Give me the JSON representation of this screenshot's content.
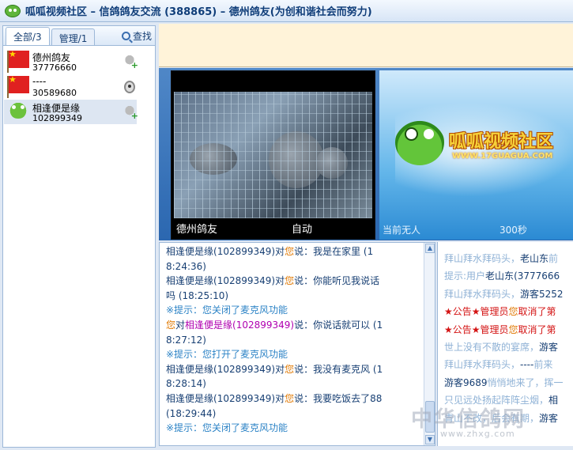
{
  "window": {
    "title": "呱呱视频社区 – 信鸽鸽友交流 (388865) – 德州鸽友(为创和谐社会而努力)"
  },
  "sidebar": {
    "tabs": [
      {
        "label": "全部/3",
        "active": true
      },
      {
        "label": "管理/1",
        "active": false
      }
    ],
    "find_label": "查找",
    "users": [
      {
        "name": "德州鸽友",
        "id": "37776660",
        "avatar": "china-flag-icon",
        "device": "microphone-icon"
      },
      {
        "name": "----",
        "id": "30589680",
        "avatar": "china-flag-icon",
        "device": "webcam-icon"
      },
      {
        "name": "相逢便是缘",
        "id": "102899349",
        "avatar": "frog-icon",
        "device": "microphone-icon"
      }
    ]
  },
  "video": {
    "left": {
      "owner": "德州鸽友",
      "mode": "自动"
    },
    "right": {
      "status": "当前无人",
      "timer": "300秒",
      "brand": "呱呱视频社区",
      "brand_url": "WWW.17GUAGUA.COM"
    }
  },
  "chat": {
    "lines": [
      [
        {
          "t": "相逢便是缘",
          "c": "n1"
        },
        {
          "t": "(102899349)对",
          "c": "n1"
        },
        {
          "t": "您",
          "c": "you"
        },
        {
          "t": "说：我是在家里 (1",
          "c": "n1"
        }
      ],
      [
        {
          "t": "8:24:36)",
          "c": "n1"
        }
      ],
      [
        {
          "t": "相逢便是缘",
          "c": "n1"
        },
        {
          "t": "(102899349)对",
          "c": "n1"
        },
        {
          "t": "您",
          "c": "you"
        },
        {
          "t": "说：你能听见我说话",
          "c": "n1"
        }
      ],
      [
        {
          "t": "吗 (18:25:10)",
          "c": "n1"
        }
      ],
      [
        {
          "t": "※提示：您关闭了麦克风功能",
          "c": "tip"
        }
      ],
      [
        {
          "t": "您",
          "c": "you"
        },
        {
          "t": "对",
          "c": "n1"
        },
        {
          "t": "相逢便是缘(102899349)",
          "c": "n2"
        },
        {
          "t": "说：你说话就可以 (1",
          "c": "n1"
        }
      ],
      [
        {
          "t": "8:27:12)",
          "c": "n1"
        }
      ],
      [
        {
          "t": "※提示：您打开了麦克风功能",
          "c": "tip"
        }
      ],
      [
        {
          "t": "相逢便是缘",
          "c": "n1"
        },
        {
          "t": "(102899349)对",
          "c": "n1"
        },
        {
          "t": "您",
          "c": "you"
        },
        {
          "t": "说：我没有麦克风 (1",
          "c": "n1"
        }
      ],
      [
        {
          "t": "8:28:14)",
          "c": "n1"
        }
      ],
      [
        {
          "t": "相逢便是缘",
          "c": "n1"
        },
        {
          "t": "(102899349)对",
          "c": "n1"
        },
        {
          "t": "您",
          "c": "you"
        },
        {
          "t": "说：我要吃饭去了88",
          "c": "n1"
        }
      ],
      [
        {
          "t": "(18:29:44)",
          "c": "n1"
        }
      ],
      [
        {
          "t": "※提示：您关闭了麦克风功能",
          "c": "tip"
        }
      ]
    ]
  },
  "public_chat": {
    "lines": [
      [
        {
          "t": "拜山拜水拜码头，",
          "c": "faint"
        },
        {
          "t": "老山东",
          "c": "dark"
        },
        {
          "t": "前",
          "c": "faint"
        }
      ],
      [
        {
          "t": "提示:用户",
          "c": "faint"
        },
        {
          "t": "老山东",
          "c": "dark"
        },
        {
          "t": "(3777666",
          "c": "dark"
        }
      ],
      [
        {
          "t": "拜山拜水拜码头，",
          "c": "faint"
        },
        {
          "t": "游客5252",
          "c": "dark"
        }
      ],
      [
        {
          "t": "★公告★管理员",
          "c": "red"
        },
        {
          "t": "您",
          "c": "you"
        },
        {
          "t": "取消了第",
          "c": "red"
        }
      ],
      [
        {
          "t": "★公告★管理员",
          "c": "red"
        },
        {
          "t": "您",
          "c": "you"
        },
        {
          "t": "取消了第",
          "c": "red"
        }
      ],
      [
        {
          "t": "世上没有不散的宴席，",
          "c": "faint"
        },
        {
          "t": "游客",
          "c": "dark"
        }
      ],
      [
        {
          "t": "拜山拜水拜码头，",
          "c": "faint"
        },
        {
          "t": "----",
          "c": "dark"
        },
        {
          "t": "前来",
          "c": "faint"
        }
      ],
      [
        {
          "t": "游客9689",
          "c": "dark"
        },
        {
          "t": "悄悄地来了，挥一",
          "c": "faint"
        }
      ],
      [
        {
          "t": "只见远处扬起阵阵尘烟，",
          "c": "faint"
        },
        {
          "t": "相",
          "c": "dark"
        }
      ],
      [
        {
          "t": "青山不改，后会有期，",
          "c": "faint"
        },
        {
          "t": "游客",
          "c": "dark"
        }
      ]
    ]
  },
  "watermark": {
    "text": "中华信鸽网",
    "url": "www.zhxg.com"
  }
}
